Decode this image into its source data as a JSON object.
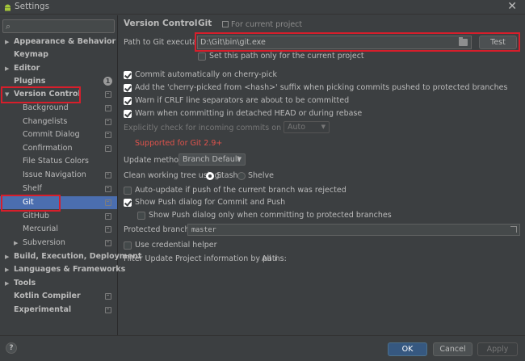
{
  "window": {
    "title": "Settings",
    "close": "✕"
  },
  "search": {
    "placeholder": "",
    "value": "",
    "icon": "search-icon"
  },
  "sidebar": {
    "items": [
      {
        "label": "Appearance & Behavior"
      },
      {
        "label": "Keymap"
      },
      {
        "label": "Editor"
      },
      {
        "label": "Plugins",
        "badge": "1"
      },
      {
        "label": "Version Control"
      },
      {
        "label": "Background"
      },
      {
        "label": "Changelists"
      },
      {
        "label": "Commit Dialog"
      },
      {
        "label": "Confirmation"
      },
      {
        "label": "File Status Colors"
      },
      {
        "label": "Issue Navigation"
      },
      {
        "label": "Shelf"
      },
      {
        "label": "Git"
      },
      {
        "label": "GitHub"
      },
      {
        "label": "Mercurial"
      },
      {
        "label": "Subversion"
      },
      {
        "label": "Build, Execution, Deployment"
      },
      {
        "label": "Languages & Frameworks"
      },
      {
        "label": "Tools"
      },
      {
        "label": "Kotlin Compiler"
      },
      {
        "label": "Experimental"
      }
    ]
  },
  "breadcrumb": {
    "parent": "Version Control",
    "separator": "›",
    "current": "Git",
    "project_note": "For current project"
  },
  "git": {
    "path_label": "Path to Git executable:",
    "path_value": "D:\\Git\\bin\\git.exe",
    "test_button": "Test",
    "set_path_only": "Set this path only for the current project",
    "commit_auto": "Commit automatically on cherry-pick",
    "add_suffix": "Add the 'cherry-picked from <hash>' suffix when picking commits pushed to protected branches",
    "warn_crlf": "Warn if CRLF line separators are about to be committed",
    "warn_detached": "Warn when committing in detached HEAD or during rebase",
    "explicit_check_label": "Explicitly check for incoming commits on remotes:",
    "explicit_check_value": "Auto",
    "supported_note": "Supported for Git 2.9+",
    "update_method_label": "Update method:",
    "update_method_value": "Branch Default",
    "clean_tree_label": "Clean working tree using:",
    "stash_label": "Stash",
    "shelve_label": "Shelve",
    "auto_update": "Auto-update if push of the current branch was rejected",
    "show_push": "Show Push dialog for Commit and Push",
    "show_push_protected": "Show Push dialog only when committing to protected branches",
    "protected_label": "Protected branches:",
    "protected_value": "master",
    "credential_helper": "Use credential helper",
    "filter_label": "Filter Update Project information by paths:",
    "filter_value": "All"
  },
  "footer": {
    "help": "?",
    "ok": "OK",
    "cancel": "Cancel",
    "apply": "Apply"
  },
  "colors": {
    "accent_selection": "#4b6eaf",
    "highlight_box": "#d71e2b",
    "warning_text": "#e0534c",
    "background": "#3c3f41"
  }
}
